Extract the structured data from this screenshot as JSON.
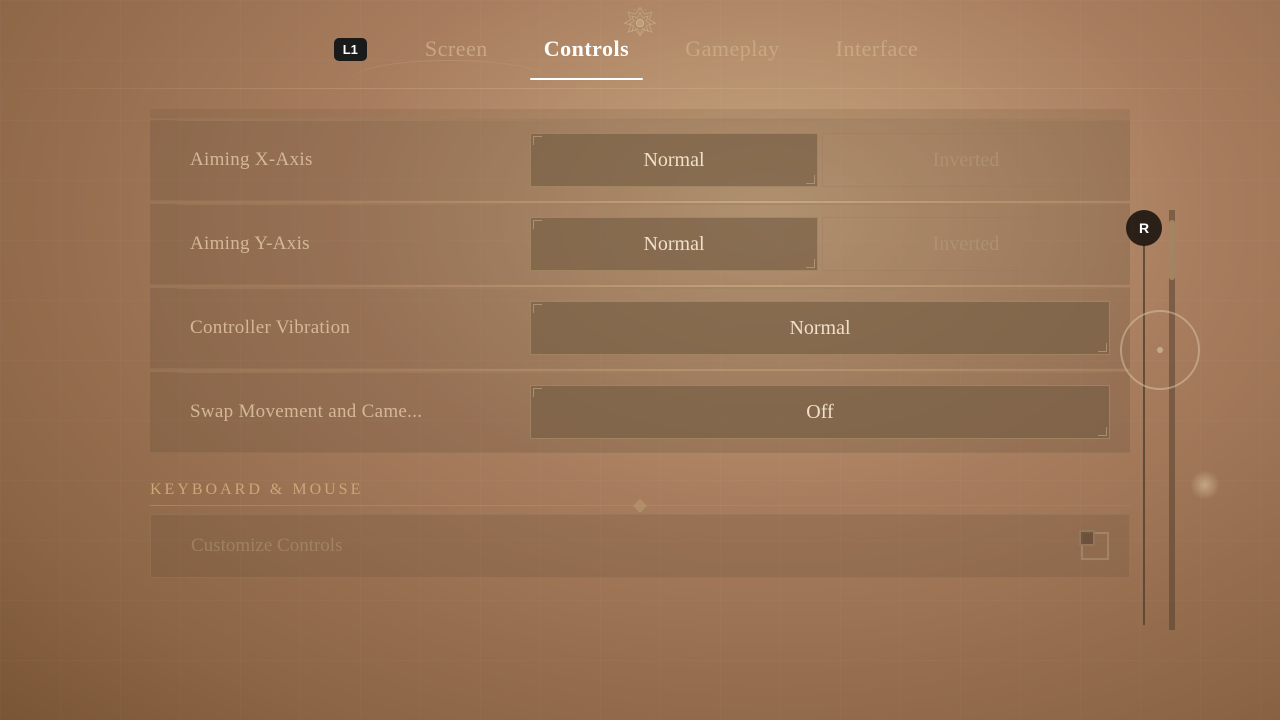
{
  "nav": {
    "l1_label": "L1",
    "tabs": [
      {
        "id": "screen",
        "label": "Screen",
        "active": false
      },
      {
        "id": "controls",
        "label": "Controls",
        "active": true
      },
      {
        "id": "gameplay",
        "label": "Gameplay",
        "active": false
      },
      {
        "id": "interface",
        "label": "Interface",
        "active": false
      }
    ]
  },
  "settings": {
    "rows": [
      {
        "id": "aiming-x-axis",
        "label": "Aiming X-Axis",
        "type": "toggle",
        "options": [
          "Normal",
          "Inverted"
        ],
        "selected": "Normal"
      },
      {
        "id": "aiming-y-axis",
        "label": "Aiming Y-Axis",
        "type": "toggle",
        "options": [
          "Normal",
          "Inverted"
        ],
        "selected": "Normal"
      },
      {
        "id": "controller-vibration",
        "label": "Controller Vibration",
        "type": "single",
        "options": [
          "Normal"
        ],
        "selected": "Normal"
      },
      {
        "id": "swap-movement",
        "label": "Swap Movement and Came...",
        "type": "single",
        "options": [
          "Off"
        ],
        "selected": "Off"
      }
    ],
    "keyboard_section_title": "KEYBOARD & MOUSE",
    "customize_label": "Customize Controls"
  },
  "scrollbar": {
    "r_label": "R"
  }
}
